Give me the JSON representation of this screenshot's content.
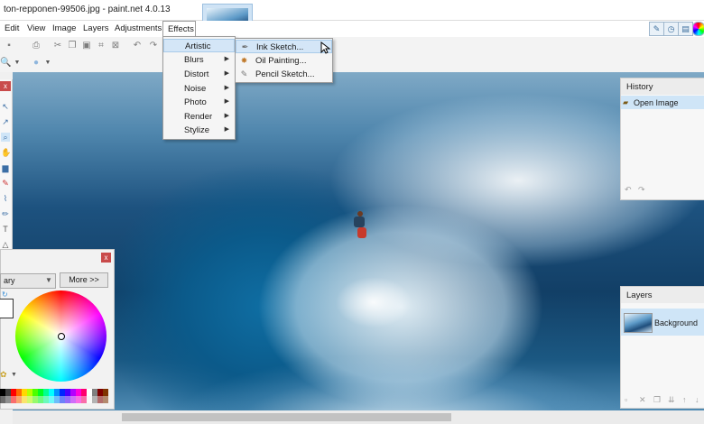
{
  "window": {
    "title": "ton-repponen-99506.jpg - paint.net 4.0.13"
  },
  "menubar": {
    "items": [
      "Edit",
      "View",
      "Image",
      "Layers",
      "Adjustments"
    ],
    "effects": "Effects"
  },
  "effects_menu": {
    "items": [
      {
        "label": "Artistic",
        "submenu": true
      },
      {
        "label": "Blurs",
        "submenu": true
      },
      {
        "label": "Distort",
        "submenu": true
      },
      {
        "label": "Noise",
        "submenu": true
      },
      {
        "label": "Photo",
        "submenu": true
      },
      {
        "label": "Render",
        "submenu": true
      },
      {
        "label": "Stylize",
        "submenu": true
      }
    ]
  },
  "artistic_submenu": {
    "items": [
      {
        "label": "Ink Sketch...",
        "icon": "brush-icon"
      },
      {
        "label": "Oil Painting...",
        "icon": "palette-icon"
      },
      {
        "label": "Pencil Sketch...",
        "icon": "pencil-icon"
      }
    ]
  },
  "colors_panel": {
    "primary_label": "ary",
    "more_label": "More >>",
    "close": "x"
  },
  "tools_panel": {
    "close": "x"
  },
  "history_panel": {
    "title": "History",
    "items": [
      "Open Image"
    ]
  },
  "layers_panel": {
    "title": "Layers",
    "items": [
      "Background"
    ]
  },
  "colors": {
    "accent": "#3a8fd6",
    "selection": "#d4e6f7",
    "close_red": "#c94b4b"
  }
}
